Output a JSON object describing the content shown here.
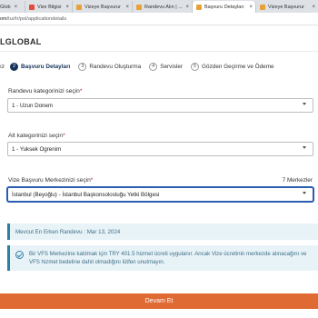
{
  "browser": {
    "tabs": [
      {
        "label": "Glob",
        "close": "×",
        "favicon_color": "#3d7bd9",
        "active": false
      },
      {
        "label": "Vize Bilgisi",
        "close": "×",
        "favicon_color": "#e34b3d",
        "active": false
      },
      {
        "label": "Vizeye Başvurur",
        "close": "×",
        "favicon_color": "#e8a13a",
        "active": false
      },
      {
        "label": "Randevu Alın | ...",
        "close": "×",
        "favicon_color": "#e8a13a",
        "active": false
      },
      {
        "label": "Başvuru Detayları",
        "close": "×",
        "favicon_color": "#e8a13a",
        "active": true
      },
      {
        "label": "Vizeye Başvurur",
        "close": "×",
        "favicon_color": "#e8a13a",
        "active": false
      }
    ],
    "url_host": "om",
    "url_path": "/tur/tr/pol/applicationdetails"
  },
  "site": {
    "brand": "LGLOBAL"
  },
  "stepper": [
    {
      "num": "",
      "label": "ız",
      "active": false
    },
    {
      "num": "2",
      "label": "Başvuru Detayları",
      "active": true
    },
    {
      "num": "3",
      "label": "Randevu Oluşturma",
      "active": false
    },
    {
      "num": "4",
      "label": "Servisler",
      "active": false
    },
    {
      "num": "5",
      "label": "Gözden Geçirme ve Ödeme",
      "active": false
    }
  ],
  "form": {
    "category": {
      "label": "Randevu kategorinizi seçin",
      "required_mark": "*",
      "value": "1 - Uzun Donem"
    },
    "subcategory": {
      "label": "Alt kategorinizi seçin",
      "required_mark": "*",
      "value": "1 - Yuksek Ogrenim"
    },
    "center": {
      "label": "Vize Başvuru Merkezinizi seçin",
      "required_mark": "*",
      "value": "İstanbul (Beyoğlu) - İstanbul Başkonsolosluğu Yetki Bölgesi",
      "count_text": "7 Merkezler"
    }
  },
  "info": {
    "earliest": "Mevcut En Erken Randevu : Mar 13, 2024",
    "fee": "Bir VFS Merkezine katılmak için TRY 401.5 hizmet ücreti uygulanır. Ancak Vize ücretinin merkezde alınacağını ve VFS hizmet bedeline dahil olmadığını lütfen unutmayın."
  },
  "actions": {
    "submit_label": "Devam Et"
  },
  "colors": {
    "accent_navy": "#15325a",
    "button_orange": "#e06a34",
    "info_bg": "#e8f3f8",
    "required_red": "#c8102e"
  }
}
